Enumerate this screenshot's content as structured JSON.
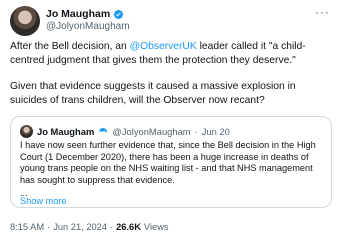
{
  "tweet": {
    "author_name": "Jo Maugham",
    "author_handle": "@JolyonMaugham",
    "text_part1_before": "After the Bell decision, an ",
    "text_mention": "@ObserverUK",
    "text_part1_after": " leader called it \"a child-centred judgment that gives them the protection they deserve.\"",
    "text_part2": "Given that evidence suggests it caused a massive explosion in suicides of trans children, will the Observer now recant?",
    "time": "8:15 AM",
    "date": "Jun 21, 2024",
    "separator": "·",
    "views_count": "26.6K",
    "views_label": "Views",
    "more_label": "···"
  },
  "quote": {
    "author_name": "Jo Maugham",
    "author_handle": "@JolyonMaugham",
    "separator": "·",
    "date": "Jun 20",
    "text": "I have now seen further evidence that, since the Bell decision in the High Court (1 December 2020), there has been a huge increase in deaths of young trans people on the NHS waiting list - and that NHS management has sought to suppress that evidence.",
    "ellipsis": "...",
    "show_more": "Show more"
  },
  "colors": {
    "accent": "#1d9bf0",
    "text": "#0f1419",
    "secondary": "#536471",
    "border": "#cfd9de"
  },
  "icons": {
    "verified": "verified-badge-icon",
    "more": "more-options-icon"
  }
}
